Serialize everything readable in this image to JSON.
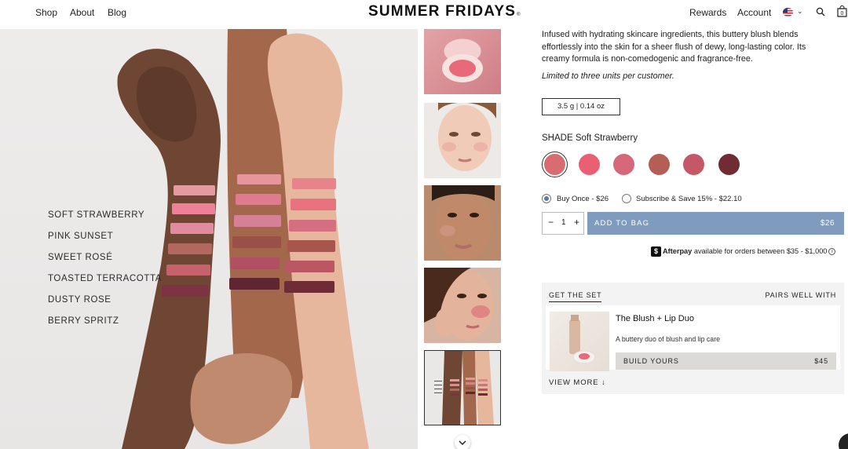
{
  "header": {
    "nav": [
      "Shop",
      "About",
      "Blog"
    ],
    "logo": "SUMMER FRIDAYS",
    "logo_mark": "®",
    "right_links": [
      "Rewards",
      "Account"
    ],
    "cart_count": "0",
    "icons": [
      "us-flag-icon",
      "chevron-down-icon",
      "search-icon",
      "bag-icon"
    ]
  },
  "hero": {
    "shades": [
      "SOFT STRAWBERRY",
      "PINK SUNSET",
      "SWEET ROSÉ",
      "TOASTED TERRACOTTA",
      "DUSTY ROSE",
      "BERRY SPRITZ"
    ]
  },
  "product": {
    "description": "Infused with hydrating skincare ingredients, this buttery blush blends effortlessly into the skin for a sheer flush of dewy, long-lasting color. Its creamy formula is non-comedogenic and fragrance-free.",
    "limit_note": "Limited to three units per customer.",
    "size": "3.5 g | 0.14 oz",
    "shade_prefix": "SHADE",
    "shade_selected": "Soft Strawberry",
    "swatch_colors": [
      "#d96c70",
      "#ea5f72",
      "#d7677a",
      "#b45f55",
      "#c45866",
      "#6f2c33"
    ],
    "purchase": {
      "buy_once": "Buy Once - $26",
      "subscribe": "Subscribe & Save 15% - $22.10",
      "quantity": "1",
      "minus": "−",
      "plus": "+",
      "add_label": "ADD TO BAG",
      "add_price": "$26"
    },
    "afterpay": {
      "brand": "Afterpay",
      "text": "available for orders between $35 - $1,000"
    }
  },
  "set": {
    "tab_active": "GET THE SET",
    "tab_other": "PAIRS WELL WITH",
    "title": "The Blush + Lip Duo",
    "subtitle": "A buttery duo of blush and lip care",
    "button_label": "BUILD YOURS",
    "button_price": "$45",
    "view_more": "VIEW MORE",
    "view_more_arrow": "↓"
  },
  "colors": {
    "accent_button": "#7f9bbd",
    "radio_selected": "#5e7ba3"
  }
}
